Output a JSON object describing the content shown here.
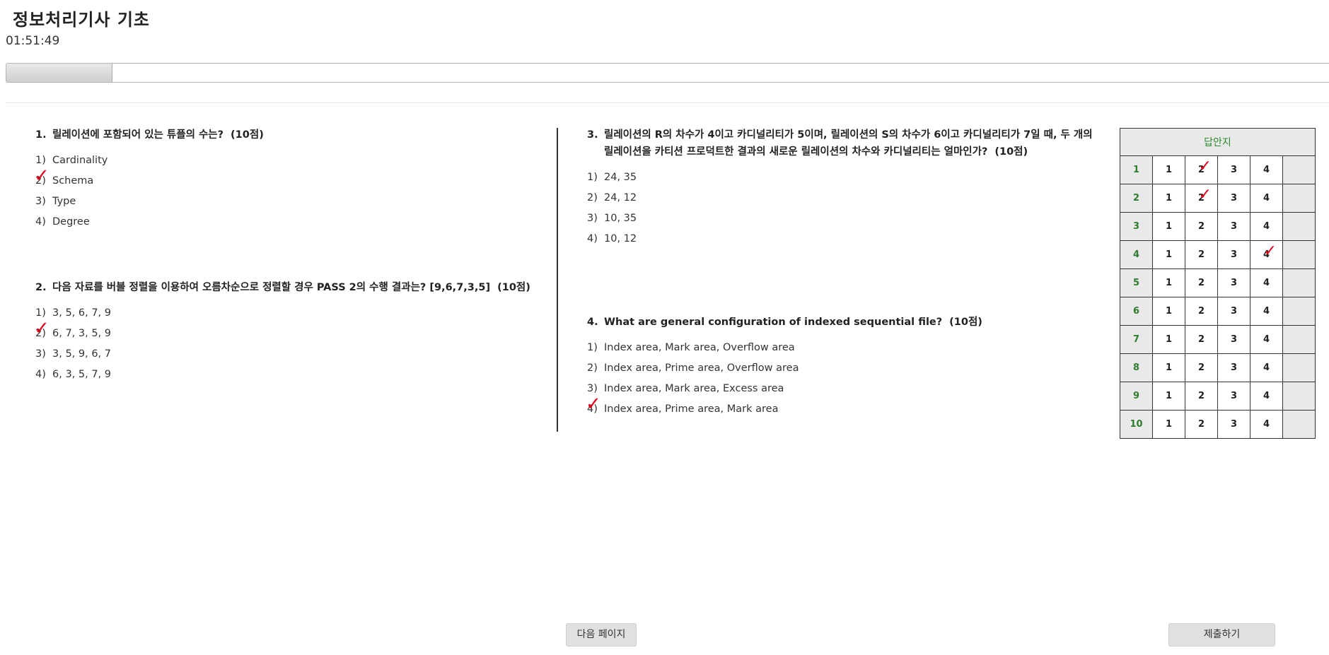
{
  "page": {
    "title": "정보처리기사 기초",
    "timer": "01:51:49",
    "progress": 0.08
  },
  "questions": [
    {
      "num": "1.",
      "text": "릴레이션에 포함되어 있는 튜플의 수는?",
      "points": "(10점)",
      "choices": [
        {
          "num": "1)",
          "text": "Cardinality"
        },
        {
          "num": "2)",
          "text": "Schema"
        },
        {
          "num": "3)",
          "text": "Type"
        },
        {
          "num": "4)",
          "text": "Degree"
        }
      ]
    },
    {
      "num": "2.",
      "text": "다음 자료를 버블 정렬을 이용하여 오름차순으로 정렬할 경우 PASS 2의 수행 결과는? [9,6,7,3,5]",
      "points": "(10점)",
      "choices": [
        {
          "num": "1)",
          "text": "3, 5, 6, 7, 9"
        },
        {
          "num": "2)",
          "text": "6, 7, 3, 5, 9"
        },
        {
          "num": "3)",
          "text": "3, 5, 9, 6, 7"
        },
        {
          "num": "4)",
          "text": "6, 3, 5, 7, 9"
        }
      ]
    },
    {
      "num": "3.",
      "text": "릴레이션의 R의 차수가 4이고 카디널리티가 5이며, 릴레이션의 S의 차수가 6이고 카디널리티가 7일 때, 두 개의 릴레이션을 카티션 프로덕트한 결과의 새로운 릴레이션의 차수와 카디널리티는 얼마인가?",
      "points": "(10점)",
      "choices": [
        {
          "num": "1)",
          "text": "24, 35"
        },
        {
          "num": "2)",
          "text": "24, 12"
        },
        {
          "num": "3)",
          "text": "10, 35"
        },
        {
          "num": "4)",
          "text": "10, 12"
        }
      ]
    },
    {
      "num": "4.",
      "text": "What are general configuration of indexed sequential file?",
      "points": "(10점)",
      "choices": [
        {
          "num": "1)",
          "text": "Index area, Mark area, Overflow area"
        },
        {
          "num": "2)",
          "text": "Index area, Prime area, Overflow area"
        },
        {
          "num": "3)",
          "text": "Index area, Mark area, Excess area"
        },
        {
          "num": "4)",
          "text": "Index area, Prime area, Mark area"
        }
      ]
    }
  ],
  "answer_sheet": {
    "title": "답안지",
    "choice_labels": [
      "1",
      "2",
      "3",
      "4"
    ],
    "rows": [
      {
        "q": "1",
        "marked": 2
      },
      {
        "q": "2",
        "marked": 2
      },
      {
        "q": "3",
        "marked": null
      },
      {
        "q": "4",
        "marked": 4
      },
      {
        "q": "5",
        "marked": null
      },
      {
        "q": "6",
        "marked": null
      },
      {
        "q": "7",
        "marked": null
      },
      {
        "q": "8",
        "marked": null
      },
      {
        "q": "9",
        "marked": null
      },
      {
        "q": "10",
        "marked": null
      }
    ]
  },
  "marks": {
    "symbol": "✓",
    "color": "#e0001a"
  },
  "buttons": {
    "next_page": "다음 페이지",
    "submit": "제출하기"
  }
}
